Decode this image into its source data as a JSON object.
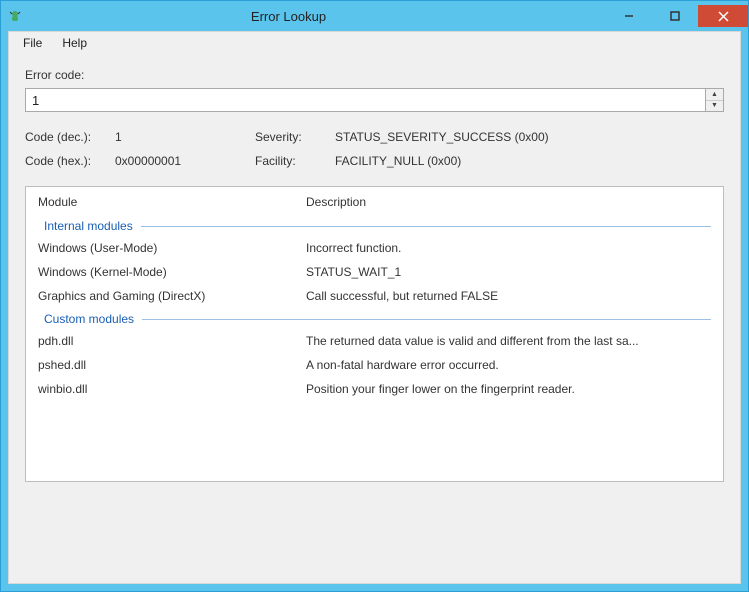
{
  "window": {
    "title": "Error Lookup"
  },
  "menu": {
    "file": "File",
    "help": "Help"
  },
  "labels": {
    "error_code": "Error code:",
    "code_dec": "Code (dec.):",
    "code_hex": "Code (hex.):",
    "severity": "Severity:",
    "facility": "Facility:"
  },
  "input": {
    "value": "1"
  },
  "info": {
    "dec": "1",
    "hex": "0x00000001",
    "severity": "STATUS_SEVERITY_SUCCESS (0x00)",
    "facility": "FACILITY_NULL (0x00)"
  },
  "columns": {
    "module": "Module",
    "description": "Description"
  },
  "groups": {
    "internal": "Internal modules",
    "custom": "Custom modules"
  },
  "rows": {
    "internal": [
      {
        "module": "Windows (User-Mode)",
        "desc": "Incorrect function."
      },
      {
        "module": "Windows (Kernel-Mode)",
        "desc": "STATUS_WAIT_1"
      },
      {
        "module": "Graphics and Gaming (DirectX)",
        "desc": "Call successful, but returned FALSE"
      }
    ],
    "custom": [
      {
        "module": "pdh.dll",
        "desc": "The returned data value is valid and different from the last sa..."
      },
      {
        "module": "pshed.dll",
        "desc": "A non-fatal hardware error occurred."
      },
      {
        "module": "winbio.dll",
        "desc": "Position your finger lower on the fingerprint reader."
      }
    ]
  }
}
